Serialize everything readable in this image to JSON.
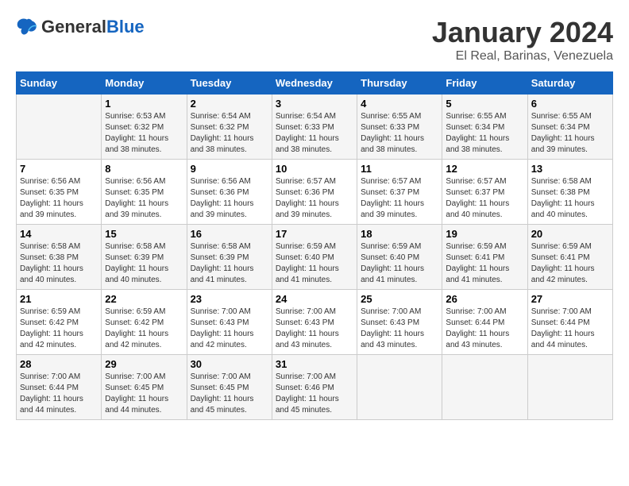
{
  "logo": {
    "general": "General",
    "blue": "Blue"
  },
  "header": {
    "title": "January 2024",
    "subtitle": "El Real, Barinas, Venezuela"
  },
  "weekdays": [
    "Sunday",
    "Monday",
    "Tuesday",
    "Wednesday",
    "Thursday",
    "Friday",
    "Saturday"
  ],
  "weeks": [
    [
      {
        "day": "",
        "info": ""
      },
      {
        "day": "1",
        "info": "Sunrise: 6:53 AM\nSunset: 6:32 PM\nDaylight: 11 hours\nand 38 minutes."
      },
      {
        "day": "2",
        "info": "Sunrise: 6:54 AM\nSunset: 6:32 PM\nDaylight: 11 hours\nand 38 minutes."
      },
      {
        "day": "3",
        "info": "Sunrise: 6:54 AM\nSunset: 6:33 PM\nDaylight: 11 hours\nand 38 minutes."
      },
      {
        "day": "4",
        "info": "Sunrise: 6:55 AM\nSunset: 6:33 PM\nDaylight: 11 hours\nand 38 minutes."
      },
      {
        "day": "5",
        "info": "Sunrise: 6:55 AM\nSunset: 6:34 PM\nDaylight: 11 hours\nand 38 minutes."
      },
      {
        "day": "6",
        "info": "Sunrise: 6:55 AM\nSunset: 6:34 PM\nDaylight: 11 hours\nand 39 minutes."
      }
    ],
    [
      {
        "day": "7",
        "info": "Sunrise: 6:56 AM\nSunset: 6:35 PM\nDaylight: 11 hours\nand 39 minutes."
      },
      {
        "day": "8",
        "info": "Sunrise: 6:56 AM\nSunset: 6:35 PM\nDaylight: 11 hours\nand 39 minutes."
      },
      {
        "day": "9",
        "info": "Sunrise: 6:56 AM\nSunset: 6:36 PM\nDaylight: 11 hours\nand 39 minutes."
      },
      {
        "day": "10",
        "info": "Sunrise: 6:57 AM\nSunset: 6:36 PM\nDaylight: 11 hours\nand 39 minutes."
      },
      {
        "day": "11",
        "info": "Sunrise: 6:57 AM\nSunset: 6:37 PM\nDaylight: 11 hours\nand 39 minutes."
      },
      {
        "day": "12",
        "info": "Sunrise: 6:57 AM\nSunset: 6:37 PM\nDaylight: 11 hours\nand 40 minutes."
      },
      {
        "day": "13",
        "info": "Sunrise: 6:58 AM\nSunset: 6:38 PM\nDaylight: 11 hours\nand 40 minutes."
      }
    ],
    [
      {
        "day": "14",
        "info": "Sunrise: 6:58 AM\nSunset: 6:38 PM\nDaylight: 11 hours\nand 40 minutes."
      },
      {
        "day": "15",
        "info": "Sunrise: 6:58 AM\nSunset: 6:39 PM\nDaylight: 11 hours\nand 40 minutes."
      },
      {
        "day": "16",
        "info": "Sunrise: 6:58 AM\nSunset: 6:39 PM\nDaylight: 11 hours\nand 41 minutes."
      },
      {
        "day": "17",
        "info": "Sunrise: 6:59 AM\nSunset: 6:40 PM\nDaylight: 11 hours\nand 41 minutes."
      },
      {
        "day": "18",
        "info": "Sunrise: 6:59 AM\nSunset: 6:40 PM\nDaylight: 11 hours\nand 41 minutes."
      },
      {
        "day": "19",
        "info": "Sunrise: 6:59 AM\nSunset: 6:41 PM\nDaylight: 11 hours\nand 41 minutes."
      },
      {
        "day": "20",
        "info": "Sunrise: 6:59 AM\nSunset: 6:41 PM\nDaylight: 11 hours\nand 42 minutes."
      }
    ],
    [
      {
        "day": "21",
        "info": "Sunrise: 6:59 AM\nSunset: 6:42 PM\nDaylight: 11 hours\nand 42 minutes."
      },
      {
        "day": "22",
        "info": "Sunrise: 6:59 AM\nSunset: 6:42 PM\nDaylight: 11 hours\nand 42 minutes."
      },
      {
        "day": "23",
        "info": "Sunrise: 7:00 AM\nSunset: 6:43 PM\nDaylight: 11 hours\nand 42 minutes."
      },
      {
        "day": "24",
        "info": "Sunrise: 7:00 AM\nSunset: 6:43 PM\nDaylight: 11 hours\nand 43 minutes."
      },
      {
        "day": "25",
        "info": "Sunrise: 7:00 AM\nSunset: 6:43 PM\nDaylight: 11 hours\nand 43 minutes."
      },
      {
        "day": "26",
        "info": "Sunrise: 7:00 AM\nSunset: 6:44 PM\nDaylight: 11 hours\nand 43 minutes."
      },
      {
        "day": "27",
        "info": "Sunrise: 7:00 AM\nSunset: 6:44 PM\nDaylight: 11 hours\nand 44 minutes."
      }
    ],
    [
      {
        "day": "28",
        "info": "Sunrise: 7:00 AM\nSunset: 6:44 PM\nDaylight: 11 hours\nand 44 minutes."
      },
      {
        "day": "29",
        "info": "Sunrise: 7:00 AM\nSunset: 6:45 PM\nDaylight: 11 hours\nand 44 minutes."
      },
      {
        "day": "30",
        "info": "Sunrise: 7:00 AM\nSunset: 6:45 PM\nDaylight: 11 hours\nand 45 minutes."
      },
      {
        "day": "31",
        "info": "Sunrise: 7:00 AM\nSunset: 6:46 PM\nDaylight: 11 hours\nand 45 minutes."
      },
      {
        "day": "",
        "info": ""
      },
      {
        "day": "",
        "info": ""
      },
      {
        "day": "",
        "info": ""
      }
    ]
  ]
}
